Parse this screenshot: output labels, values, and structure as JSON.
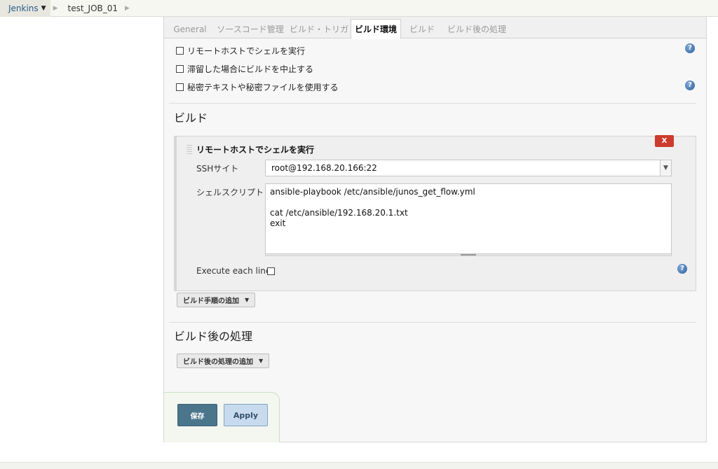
{
  "breadcrumb": {
    "items": [
      {
        "label": "Jenkins"
      },
      {
        "label": "test_JOB_01"
      }
    ]
  },
  "tabs": [
    {
      "label": "General"
    },
    {
      "label": "ソースコード管理"
    },
    {
      "label": "ビルド・トリガ"
    },
    {
      "label": "ビルド環境",
      "active": true
    },
    {
      "label": "ビルド"
    },
    {
      "label": "ビルド後の処理"
    }
  ],
  "build_env": {
    "options": [
      {
        "label": "リモートホストでシェルを実行",
        "checked": false
      },
      {
        "label": "滞留した場合にビルドを中止する",
        "checked": false
      },
      {
        "label": "秘密テキストや秘密ファイルを使用する",
        "checked": false
      }
    ]
  },
  "build": {
    "heading": "ビルド",
    "step": {
      "title": "リモートホストでシェルを実行",
      "delete_label": "X",
      "ssh_site_label": "SSHサイト",
      "ssh_site_value": "root@192.168.20.166:22",
      "script_label": "シェルスクリプト",
      "script_value": "ansible-playbook /etc/ansible/junos_get_flow.yml\n\ncat /etc/ansible/192.168.20.1.txt\nexit",
      "execute_each_line_label": "Execute each line",
      "execute_each_line_checked": false
    },
    "add_step_label": "ビルド手順の追加"
  },
  "post_build": {
    "heading": "ビルド後の処理",
    "add_action_label": "ビルド後の処理の追加"
  },
  "actions": {
    "save_label": "保存",
    "apply_label": "Apply"
  },
  "colors": {
    "save_button": "#4b758b",
    "apply_button": "#c8dbee",
    "delete_button": "#cc3b2e",
    "help_icon": "#2c5d9a"
  }
}
